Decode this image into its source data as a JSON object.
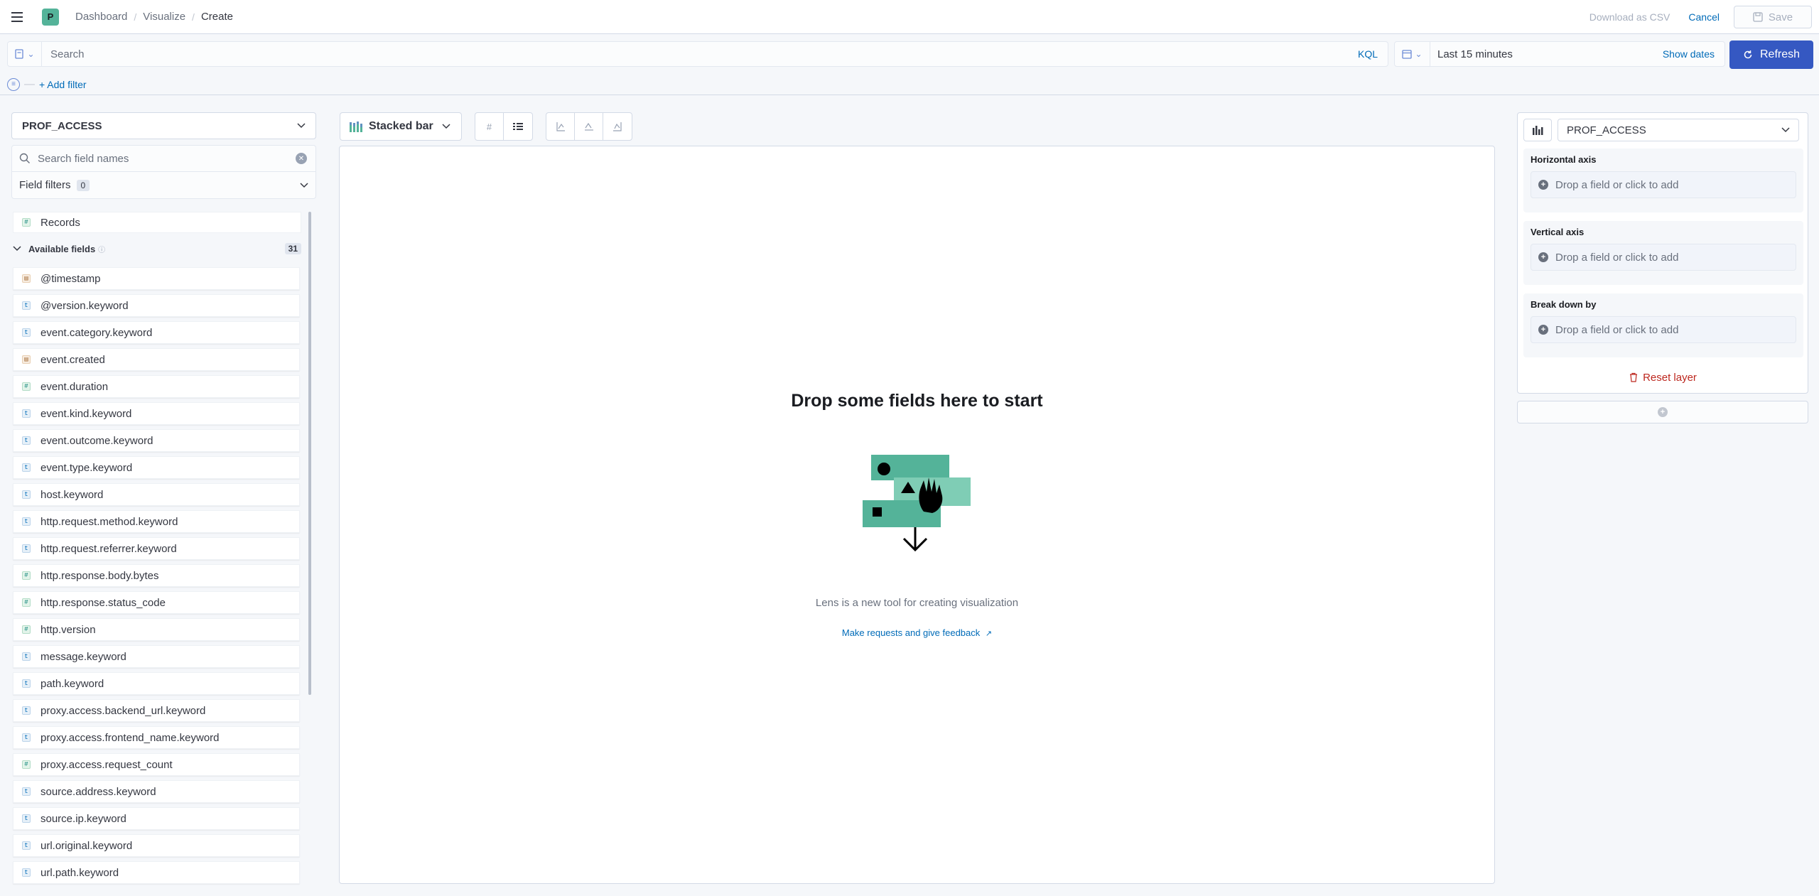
{
  "header": {
    "avatar_letter": "P",
    "breadcrumbs": [
      "Dashboard",
      "Visualize",
      "Create"
    ],
    "download_csv": "Download as CSV",
    "cancel": "Cancel",
    "save": "Save"
  },
  "query": {
    "search_placeholder": "Search",
    "language": "KQL",
    "time_range": "Last 15 minutes",
    "show_dates": "Show dates",
    "refresh": "Refresh",
    "add_filter": "+ Add filter"
  },
  "left": {
    "index_pattern": "PROF_ACCESS",
    "field_search_placeholder": "Search field names",
    "field_filters_label": "Field filters",
    "field_filters_count": "0",
    "records_label": "Records",
    "available_label": "Available fields",
    "available_count": "31",
    "fields": [
      {
        "name": "@timestamp",
        "type": "date"
      },
      {
        "name": "@version.keyword",
        "type": "string"
      },
      {
        "name": "event.category.keyword",
        "type": "string"
      },
      {
        "name": "event.created",
        "type": "date"
      },
      {
        "name": "event.duration",
        "type": "number"
      },
      {
        "name": "event.kind.keyword",
        "type": "string"
      },
      {
        "name": "event.outcome.keyword",
        "type": "string"
      },
      {
        "name": "event.type.keyword",
        "type": "string"
      },
      {
        "name": "host.keyword",
        "type": "string"
      },
      {
        "name": "http.request.method.keyword",
        "type": "string"
      },
      {
        "name": "http.request.referrer.keyword",
        "type": "string"
      },
      {
        "name": "http.response.body.bytes",
        "type": "number"
      },
      {
        "name": "http.response.status_code",
        "type": "number"
      },
      {
        "name": "http.version",
        "type": "number"
      },
      {
        "name": "message.keyword",
        "type": "string"
      },
      {
        "name": "path.keyword",
        "type": "string"
      },
      {
        "name": "proxy.access.backend_url.keyword",
        "type": "string"
      },
      {
        "name": "proxy.access.frontend_name.keyword",
        "type": "string"
      },
      {
        "name": "proxy.access.request_count",
        "type": "number"
      },
      {
        "name": "source.address.keyword",
        "type": "string"
      },
      {
        "name": "source.ip.keyword",
        "type": "string"
      },
      {
        "name": "url.original.keyword",
        "type": "string"
      },
      {
        "name": "url.path.keyword",
        "type": "string"
      }
    ]
  },
  "workspace": {
    "chart_type": "Stacked bar",
    "drop_title": "Drop some fields here to start",
    "description": "Lens is a new tool for creating visualization",
    "feedback_link": "Make requests and give feedback",
    "accent_color": "#54b399"
  },
  "right": {
    "layer_index": "PROF_ACCESS",
    "dimensions": [
      {
        "label": "Horizontal axis",
        "placeholder": "Drop a field or click to add"
      },
      {
        "label": "Vertical axis",
        "placeholder": "Drop a field or click to add"
      },
      {
        "label": "Break down by",
        "placeholder": "Drop a field or click to add"
      }
    ],
    "reset_layer": "Reset layer"
  }
}
